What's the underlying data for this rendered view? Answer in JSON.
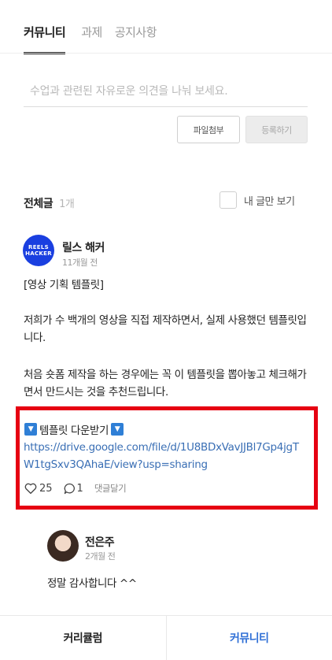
{
  "tabs": [
    {
      "label": "커뮤니티",
      "active": true
    },
    {
      "label": "과제",
      "active": false
    },
    {
      "label": "공지사항",
      "active": false
    }
  ],
  "comment_input": {
    "placeholder": "수업과 관련된 자유로운 의견을 나눠 보세요.",
    "value": ""
  },
  "buttons": {
    "attach": "파일첨부",
    "register": "등록하기"
  },
  "list_header": {
    "title": "전체글",
    "count": "1개",
    "my_posts_label": "내 글만 보기",
    "my_posts_checked": false
  },
  "post": {
    "avatar_text": [
      "REELS",
      "HACKER"
    ],
    "author": "릴스 해커",
    "time": "11개월 전",
    "title_line": "[영상 기획 템플릿]",
    "paragraph1": "저희가 수 백개의 영상을 직접 제작하면서, 실제 사용했던 템플릿입니다.",
    "paragraph2": "처음 숏폼 제작을 하는 경우에는 꼭 이 템플릿을 뽑아놓고 체크해가면서 만드시는 것을 추천드립니다.",
    "download_label": "템플릿 다운받기",
    "download_icon": "down-triangle-icon",
    "link": "https://drive.google.com/file/d/1U8BDxVavJJBl7Gp4jgTW1tgSxv3QAhaE/view?usp=sharing",
    "likes": "25",
    "comments": "1",
    "reply_action": "댓글달기"
  },
  "reply": {
    "author": "전은주",
    "time": "2개월 전",
    "text": "정말 감사합니다 ^^"
  },
  "bottom_nav": {
    "curriculum": "커리큘럼",
    "community": "커뮤니티",
    "active": "community"
  },
  "colors": {
    "accent": "#2f6fd6",
    "highlight_border": "#e60012",
    "brand_avatar": "#1a3fe0",
    "link": "#3a6fb5"
  }
}
